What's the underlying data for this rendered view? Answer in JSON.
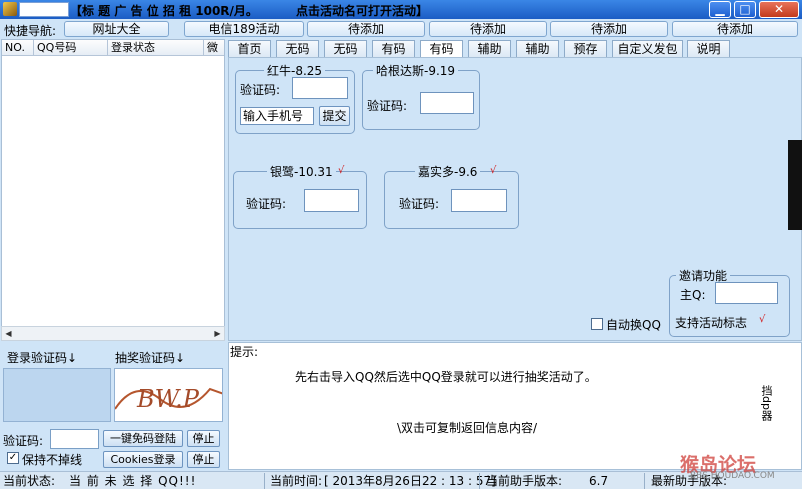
{
  "window": {
    "title": "【标 题 广 告 位 招 租 100R/月。",
    "link": "点击活动名可打开活动】",
    "minimize": "▁",
    "maximize": "□",
    "close": "✕"
  },
  "nav": {
    "label": "快捷导航:",
    "buttons": [
      "网址大全",
      "电信189活动",
      "待添加",
      "待添加",
      "待添加",
      "待添加"
    ]
  },
  "grid": {
    "columns": [
      "NO.",
      "QQ号码",
      "登录状态",
      "微"
    ]
  },
  "left_panel": {
    "login_captcha_label": "登录验证码↓",
    "lottery_captcha_label": "抽奖验证码↓",
    "captcha_text": "BW.P",
    "captcha_label": "验证码:",
    "captcha_value": "",
    "free_login_button": "一键免码登陆",
    "stop_button_1": "停止",
    "keep_online_label": "保持不掉线",
    "keep_online_checked": true,
    "cookies_login_button": "Cookies登录",
    "stop_button_2": "停止"
  },
  "tabs": [
    "首页",
    "无码",
    "无码",
    "有码",
    "有码",
    "辅助",
    "辅助",
    "预存",
    "自定义发包",
    "说明"
  ],
  "active_tab": 4,
  "groups": {
    "redbull": {
      "title": "红牛-8.25",
      "captcha_label": "验证码:",
      "captcha_value": "",
      "phone_value": "输入手机号",
      "submit": "提交"
    },
    "haagen": {
      "title": "哈根达斯-9.19",
      "captcha_label": "验证码:",
      "captcha_value": ""
    },
    "yinlu": {
      "title": "银鹭-10.31",
      "checked": "√",
      "captcha_label": "验证码:",
      "captcha_value": ""
    },
    "carrefour": {
      "title": "嘉实多-9.6",
      "checked": "√",
      "captcha_label": "验证码:",
      "captcha_value": ""
    },
    "invite": {
      "title": "邀请功能",
      "main_qq_label": "主Q:",
      "main_qq_value": "",
      "support_label": "支持活动标志",
      "support_mark": "√"
    }
  },
  "auto_switch": {
    "label": "自动换QQ",
    "checked": false
  },
  "tip": {
    "label": "提示:",
    "message": "先右击导入QQ然后选中QQ登录就可以进行抽奖活动了。",
    "copy_hint": "\\双击可复制返回信息内容/",
    "side_text": "挡dp器"
  },
  "status": {
    "state_label": "当前状态:",
    "state_value": "当 前 未 选 择 QQ!!!",
    "time_label": "当前时间:",
    "time_value": "[ 2013年8月26日22 : 13 : 57]",
    "version_label": "当前助手版本:",
    "version_value": "6.7",
    "latest_label": "最新助手版本:"
  },
  "watermark": {
    "text": "猴岛论坛",
    "url": "BBS.HOUDAO.COM"
  },
  "colors": {
    "window_bg": "#cfe4f7",
    "titlebar": "#1b5cc4",
    "check_mark": "#d01818"
  }
}
